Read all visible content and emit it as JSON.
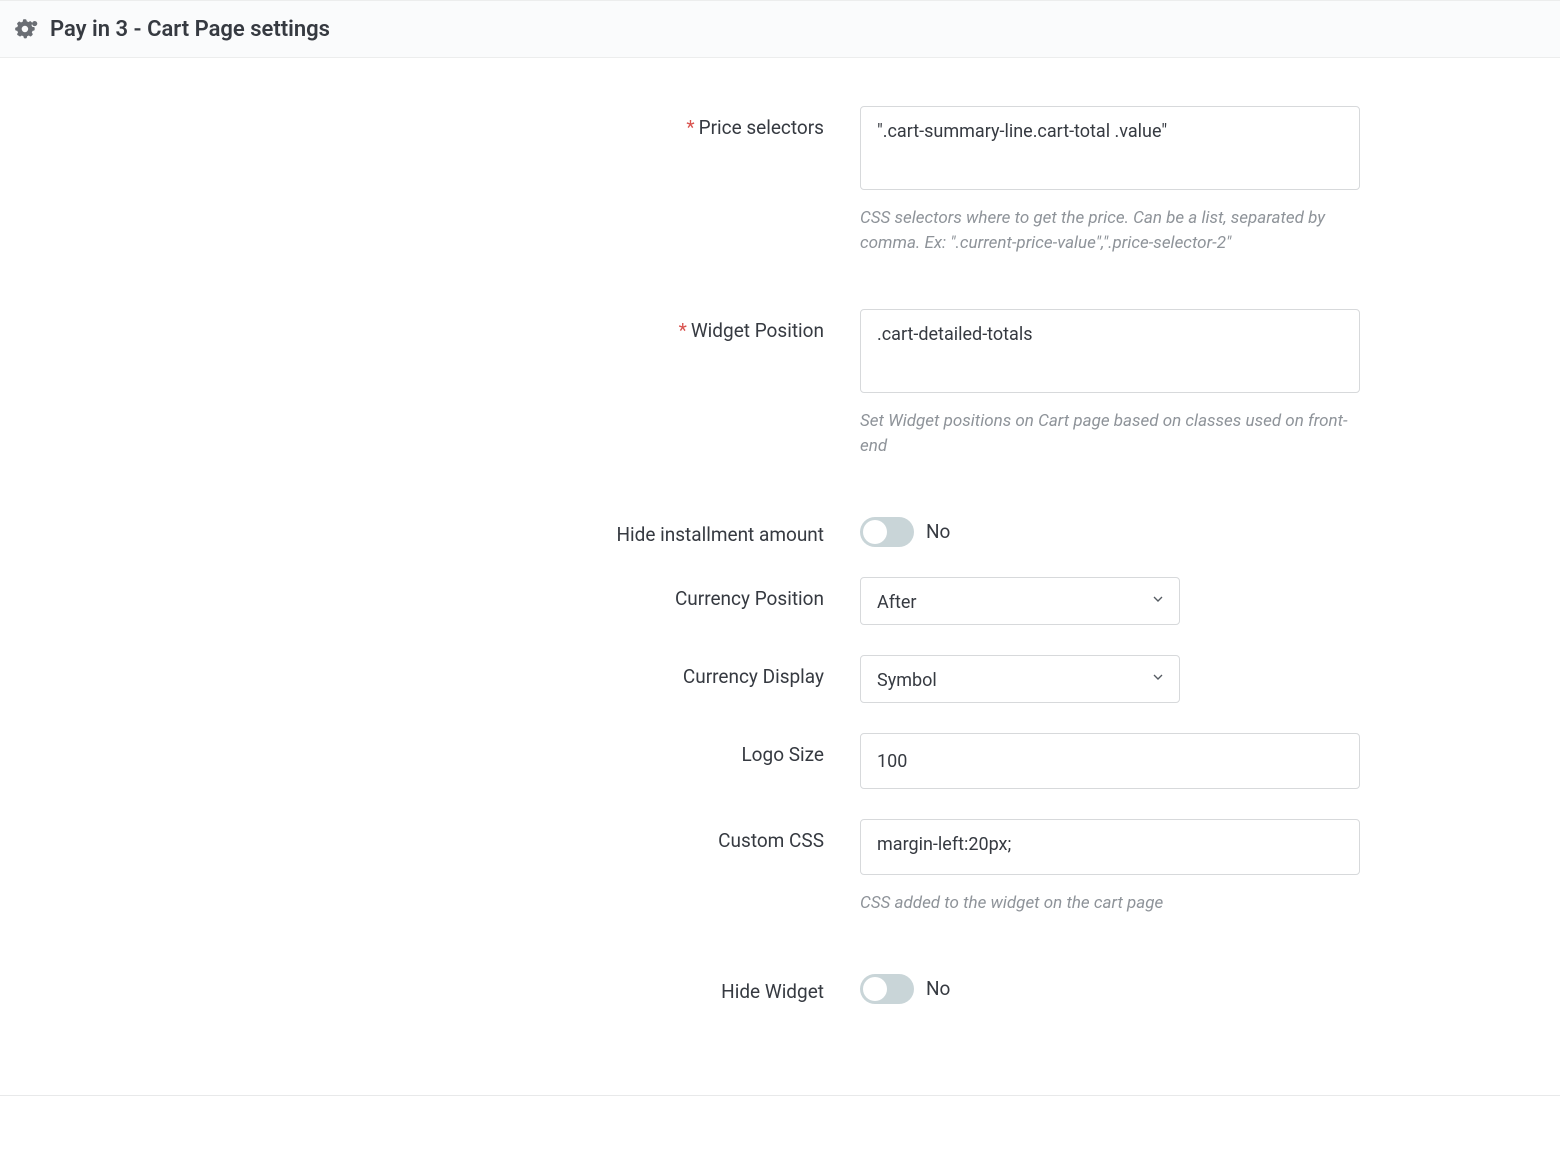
{
  "panel": {
    "title": "Pay in 3 - Cart Page settings"
  },
  "fields": {
    "price_selectors": {
      "label": "Price selectors",
      "required": true,
      "value": "\".cart-summary-line.cart-total .value\"",
      "help": "CSS selectors where to get the price. Can be a list, separated by comma. Ex: \".current-price-value\",\".price-selector-2\""
    },
    "widget_position": {
      "label": "Widget Position",
      "required": true,
      "value": ".cart-detailed-totals",
      "help": "Set Widget positions on Cart page based on classes used on front-end"
    },
    "hide_installment": {
      "label": "Hide installment amount",
      "state_text": "No"
    },
    "currency_position": {
      "label": "Currency Position",
      "value": "After"
    },
    "currency_display": {
      "label": "Currency Display",
      "value": "Symbol"
    },
    "logo_size": {
      "label": "Logo Size",
      "value": "100"
    },
    "custom_css": {
      "label": "Custom CSS",
      "value": "margin-left:20px;",
      "help": "CSS added to the widget on the cart page"
    },
    "hide_widget": {
      "label": "Hide Widget",
      "state_text": "No"
    }
  }
}
